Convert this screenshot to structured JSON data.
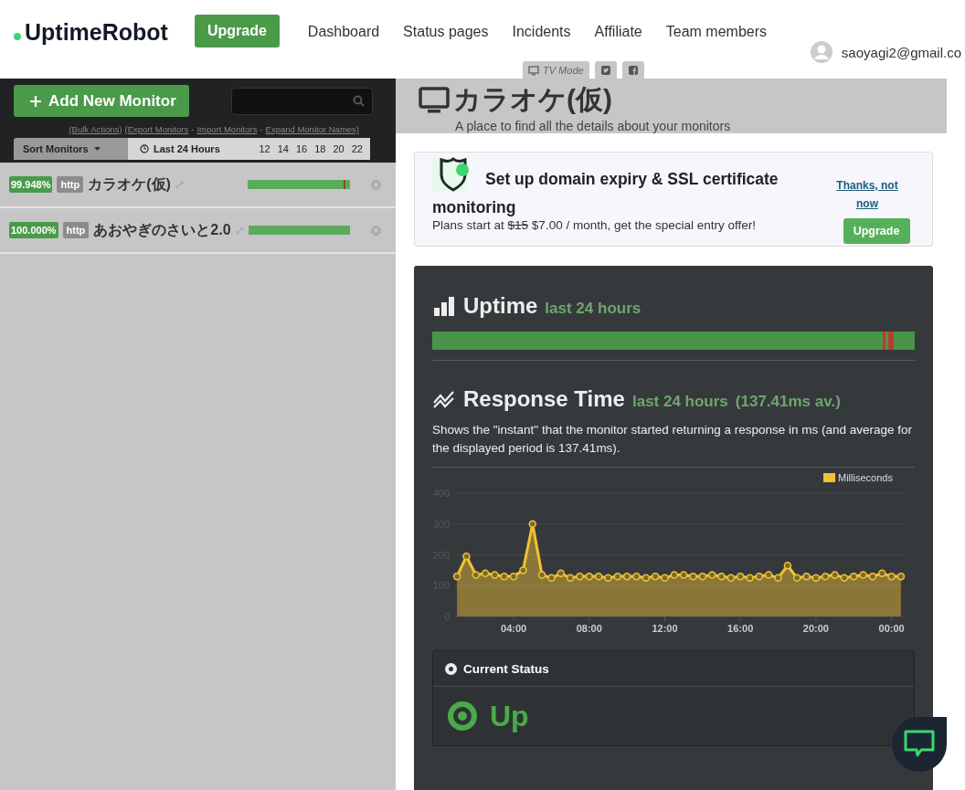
{
  "header": {
    "logo": "UptimeRobot",
    "upgrade": "Upgrade",
    "nav": [
      {
        "label": "Dashboard"
      },
      {
        "label": "Status pages"
      },
      {
        "label": "Incidents"
      },
      {
        "label": "Affiliate"
      },
      {
        "label": "Team members"
      }
    ],
    "user": "saoyagi2@gmail.co",
    "tabs": [
      {
        "kind": "text",
        "label": "TV Mode"
      },
      {
        "kind": "twitter"
      },
      {
        "kind": "facebook"
      }
    ]
  },
  "sidebar": {
    "add_button": "Add New Monitor",
    "links": [
      {
        "label": "(Bulk Actions)"
      },
      {
        "label": "(Export Monitors"
      },
      {
        "label": "Import Monitors"
      },
      {
        "label": "Expand Monitor Names)"
      }
    ],
    "separator": "-",
    "sort": "Sort Monitors",
    "period": "Last 24 Hours",
    "hours": [
      "12",
      "14",
      "16",
      "18",
      "20",
      "22"
    ],
    "monitors": [
      {
        "uptime": "99.948%",
        "type": "http",
        "name": "カラオケ(仮)",
        "incident": true
      },
      {
        "uptime": "100.000%",
        "type": "http",
        "name": "あおやぎのさいと2.0",
        "incident": false
      }
    ]
  },
  "monitor": {
    "title": "カラオケ(仮)",
    "subtitle": "A place to find all the details about your monitors"
  },
  "promo": {
    "title": "Set up domain expiry & SSL certificate monitoring",
    "text_before": "Plans start at",
    "old_price": "$15",
    "text_after": "$7.00 / month, get the special entry offer!",
    "dismiss": "Thanks, not now",
    "button": "Upgrade"
  },
  "uptime": {
    "title": "Uptime",
    "period": "last 24 hours"
  },
  "response": {
    "title": "Response Time",
    "period": "last 24 hours",
    "average": "(137.41ms av.)",
    "description": "Shows the \"instant\" that the monitor started returning a response in ms (and average for the displayed period is 137.41ms).",
    "chart_data": {
      "type": "area",
      "x": [
        1,
        1.5,
        2,
        2.5,
        3,
        3.5,
        4,
        4.5,
        5,
        5.5,
        6,
        6.5,
        7,
        7.5,
        8,
        8.5,
        9,
        9.5,
        10,
        10.5,
        11,
        11.5,
        12,
        12.5,
        13,
        13.5,
        14,
        14.5,
        15,
        15.5,
        16,
        16.5,
        17,
        17.5,
        18,
        18.5,
        19,
        19.5,
        20,
        20.5,
        21,
        21.5,
        22,
        22.5,
        23,
        23.5,
        24,
        24.5
      ],
      "series": [
        {
          "name": "Milliseconds",
          "color": "#f1c232",
          "values": [
            130,
            195,
            135,
            140,
            135,
            130,
            130,
            150,
            300,
            135,
            125,
            140,
            125,
            130,
            130,
            130,
            125,
            130,
            130,
            130,
            125,
            130,
            125,
            135,
            135,
            130,
            130,
            135,
            130,
            125,
            130,
            125,
            130,
            135,
            125,
            165,
            125,
            130,
            125,
            130,
            135,
            125,
            130,
            135,
            130,
            140,
            130,
            130
          ]
        }
      ],
      "xlim": [
        0.9,
        24.6
      ],
      "ylim": [
        0,
        400
      ],
      "grid": true,
      "yticks": [
        0,
        100,
        200,
        300,
        400
      ],
      "xticks": [
        {
          "value": 4,
          "label": "04:00"
        },
        {
          "value": 8,
          "label": "08:00"
        },
        {
          "value": 12,
          "label": "12:00"
        },
        {
          "value": 16,
          "label": "16:00"
        },
        {
          "value": 20,
          "label": "20:00"
        },
        {
          "value": 24,
          "label": "00:00"
        }
      ]
    }
  },
  "current_status": {
    "title": "Current Status",
    "status": "Up"
  }
}
